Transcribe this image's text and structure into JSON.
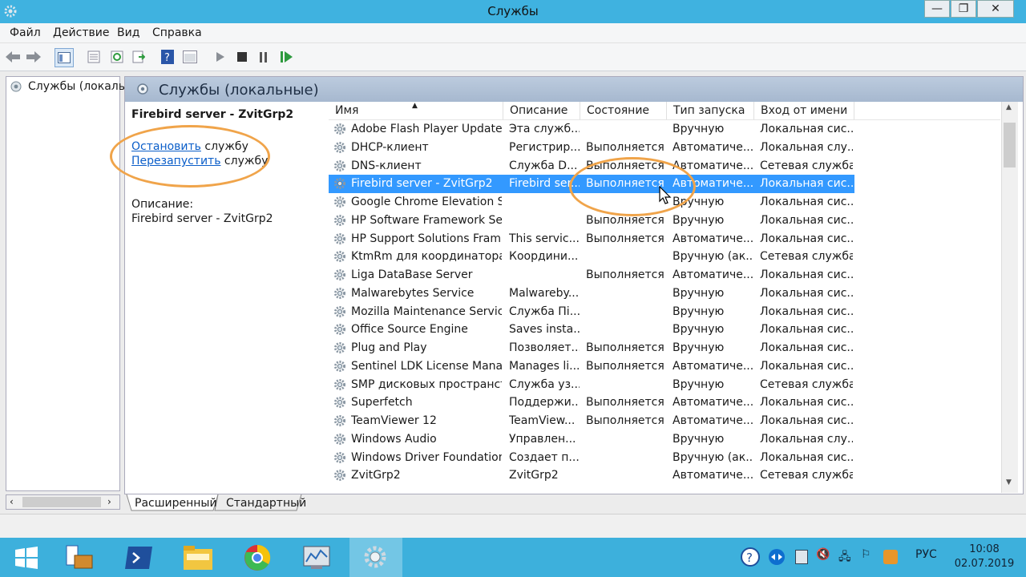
{
  "window": {
    "title": "Службы",
    "controls": {
      "minimize": "—",
      "maximize": "❐",
      "close": "✕"
    }
  },
  "menu": [
    "Файл",
    "Действие",
    "Вид",
    "Справка"
  ],
  "tree": {
    "root_label": "Службы (локалы"
  },
  "panel": {
    "title": "Службы (локальные)"
  },
  "detail": {
    "service_name": "Firebird server - ZvitGrp2",
    "stop_link": "Остановить",
    "stop_suffix": " службу",
    "restart_link": "Перезапустить",
    "restart_suffix": " службу",
    "desc_label": "Описание:",
    "desc_text": "Firebird server - ZvitGrp2"
  },
  "table": {
    "columns": [
      "Имя",
      "Описание",
      "Состояние",
      "Тип запуска",
      "Вход от имени"
    ],
    "rows": [
      {
        "name": "Adobe Flash Player Update ...",
        "desc": "Эта служб...",
        "state": "",
        "startup": "Вручную",
        "logon": "Локальная сис..."
      },
      {
        "name": "DHCP-клиент",
        "desc": "Регистрир...",
        "state": "Выполняется",
        "startup": "Автоматиче...",
        "logon": "Локальная слу..."
      },
      {
        "name": "DNS-клиент",
        "desc": "Служба D...",
        "state": "Выполняется",
        "startup": "Автоматиче...",
        "logon": "Сетевая служба"
      },
      {
        "name": "Firebird server - ZvitGrp2",
        "desc": "Firebird ser...",
        "state": "Выполняется",
        "startup": "Автоматиче...",
        "logon": "Локальная сис...",
        "selected": true
      },
      {
        "name": "Google Chrome Elevation S...",
        "desc": "",
        "state": "",
        "startup": "Вручную",
        "logon": "Локальная сис..."
      },
      {
        "name": "HP Software Framework Ser...",
        "desc": "",
        "state": "Выполняется",
        "startup": "Вручную",
        "logon": "Локальная сис..."
      },
      {
        "name": "HP Support Solutions Fram...",
        "desc": "This servic...",
        "state": "Выполняется",
        "startup": "Автоматиче...",
        "logon": "Локальная сис..."
      },
      {
        "name": "KtmRm для координатора ...",
        "desc": "Координи...",
        "state": "",
        "startup": "Вручную (ак...",
        "logon": "Сетевая служба"
      },
      {
        "name": "Liga DataBase Server",
        "desc": "",
        "state": "Выполняется",
        "startup": "Автоматиче...",
        "logon": "Локальная сис..."
      },
      {
        "name": "Malwarebytes Service",
        "desc": "Malwareby...",
        "state": "",
        "startup": "Вручную",
        "logon": "Локальная сис..."
      },
      {
        "name": "Mozilla Maintenance Service",
        "desc": "Служба Пі...",
        "state": "",
        "startup": "Вручную",
        "logon": "Локальная сис..."
      },
      {
        "name": "Office Source Engine",
        "desc": "Saves insta...",
        "state": "",
        "startup": "Вручную",
        "logon": "Локальная сис..."
      },
      {
        "name": "Plug and Play",
        "desc": "Позволяет...",
        "state": "Выполняется",
        "startup": "Вручную",
        "logon": "Локальная сис..."
      },
      {
        "name": "Sentinel LDK License Mana...",
        "desc": "Manages li...",
        "state": "Выполняется",
        "startup": "Автоматиче...",
        "logon": "Локальная сис..."
      },
      {
        "name": "SMP дисковых пространст...",
        "desc": "Служба уз...",
        "state": "",
        "startup": "Вручную",
        "logon": "Сетевая служба"
      },
      {
        "name": "Superfetch",
        "desc": "Поддержи...",
        "state": "Выполняется",
        "startup": "Автоматиче...",
        "logon": "Локальная сис..."
      },
      {
        "name": "TeamViewer 12",
        "desc": "TeamView...",
        "state": "Выполняется",
        "startup": "Автоматиче...",
        "logon": "Локальная сис..."
      },
      {
        "name": "Windows Audio",
        "desc": "Управлен...",
        "state": "",
        "startup": "Вручную",
        "logon": "Локальная слу..."
      },
      {
        "name": "Windows Driver Foundation...",
        "desc": "Создает п...",
        "state": "",
        "startup": "Вручную (ак...",
        "logon": "Локальная сис..."
      },
      {
        "name": "ZvitGrp2",
        "desc": "ZvitGrp2",
        "state": "",
        "startup": "Автоматиче...",
        "logon": "Сетевая служба"
      }
    ]
  },
  "tabs": [
    "Расширенный",
    "Стандартный"
  ],
  "taskbar": {
    "lang": "РУС",
    "time": "10:08",
    "date": "02.07.2019"
  },
  "colors": {
    "selection": "#3399ff",
    "titlebar": "#3fb2e0",
    "annotation": "#f0a44a",
    "link": "#0b5ec9"
  }
}
